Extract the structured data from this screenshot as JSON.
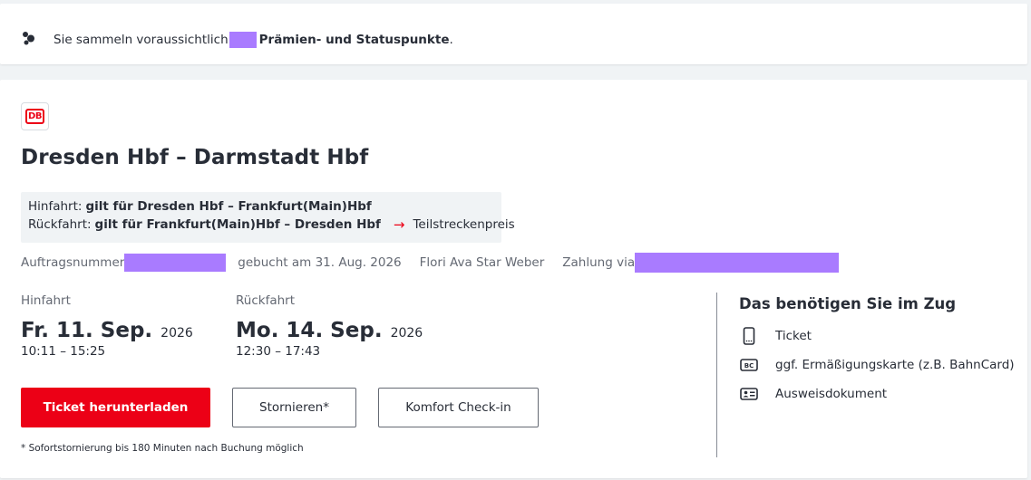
{
  "points": {
    "prefix": "Sie sammeln voraussichtlich",
    "bold": "Prämien- und Statuspunkte",
    "suffix": "."
  },
  "logo": {
    "text": "DB"
  },
  "route": {
    "title": "Dresden Hbf – Darmstadt Hbf"
  },
  "validity": {
    "outbound_label": "Hinfahrt:",
    "outbound_value": "gilt für Dresden Hbf – Frankfurt(Main)Hbf",
    "return_label": "Rückfahrt:",
    "return_value": "gilt für Frankfurt(Main)Hbf – Dresden Hbf",
    "partial_price": "Teilstreckenpreis"
  },
  "order": {
    "number_label": "Auftragsnummer",
    "booked": "gebucht am 31. Aug. 2026",
    "traveller": "Flori Ava Star Weber",
    "payment_label": "Zahlung via"
  },
  "outbound": {
    "label": "Hinfahrt",
    "day": "Fr. 11. Sep.",
    "year": "2026",
    "times": "10:11 – 15:25"
  },
  "return": {
    "label": "Rückfahrt",
    "day": "Mo. 14. Sep.",
    "year": "2026",
    "times": "12:30 – 17:43"
  },
  "actions": {
    "download": "Ticket herunterladen",
    "cancel": "Stornieren*",
    "checkin": "Komfort Check-in"
  },
  "footnote": "* Sofortstornierung bis 180 Minuten nach Buchung möglich",
  "needs": {
    "heading": "Das benötigen Sie im Zug",
    "items": [
      {
        "icon": "phone-icon",
        "label": "Ticket"
      },
      {
        "icon": "bahncard-icon",
        "label": "ggf. Ermäßigungskarte (z.B. BahnCard)"
      },
      {
        "icon": "id-card-icon",
        "label": "Ausweisdokument"
      }
    ]
  },
  "colors": {
    "brand_red": "#ec0016",
    "text": "#282d37",
    "muted": "#646973",
    "redaction": "#a97bff"
  }
}
